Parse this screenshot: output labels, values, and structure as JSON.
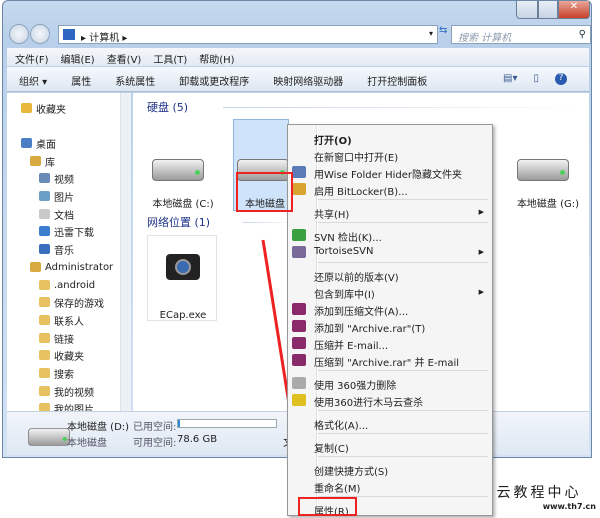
{
  "window": {
    "controls": [
      "minimize",
      "maximize",
      "close"
    ]
  },
  "address": {
    "path": "计算机",
    "search_placeholder": "搜索 计算机"
  },
  "menubar": [
    "文件(F)",
    "编辑(E)",
    "查看(V)",
    "工具(T)",
    "帮助(H)"
  ],
  "toolbar": [
    "组织 ▾",
    "属性",
    "系统属性",
    "卸载或更改程序",
    "映射网络驱动器",
    "打开控制面板"
  ],
  "sidebar": [
    {
      "label": "收藏夹",
      "color": "#e8b83a",
      "indent": 0
    },
    {
      "label": "桌面",
      "color": "#4a7fc6",
      "indent": 0
    },
    {
      "label": "库",
      "color": "#d8a940",
      "indent": 1
    },
    {
      "label": "视频",
      "color": "#6a8bb8",
      "indent": 2
    },
    {
      "label": "图片",
      "color": "#6aa0c8",
      "indent": 2
    },
    {
      "label": "文档",
      "color": "#c9c9c9",
      "indent": 2
    },
    {
      "label": "迅雷下载",
      "color": "#3a7fd0",
      "indent": 2
    },
    {
      "label": "音乐",
      "color": "#3a6fc0",
      "indent": 2
    },
    {
      "label": "Administrator",
      "color": "#d8a940",
      "indent": 1
    },
    {
      "label": ".android",
      "color": "#e8c260",
      "indent": 2
    },
    {
      "label": "保存的游戏",
      "color": "#e8c260",
      "indent": 2
    },
    {
      "label": "联系人",
      "color": "#e8c260",
      "indent": 2
    },
    {
      "label": "链接",
      "color": "#e8c260",
      "indent": 2
    },
    {
      "label": "收藏夹",
      "color": "#e8c260",
      "indent": 2
    },
    {
      "label": "搜索",
      "color": "#e8c260",
      "indent": 2
    },
    {
      "label": "我的视频",
      "color": "#e8c260",
      "indent": 2
    },
    {
      "label": "我的图片",
      "color": "#e8c260",
      "indent": 2
    }
  ],
  "content": {
    "hdd_group": "硬盘 (5)",
    "net_group": "网络位置 (1)",
    "drives": [
      {
        "label": "本地磁盘 (C:)"
      },
      {
        "label": "本地磁盘 (D:)"
      },
      {
        "label": "本地磁盘 (G:)"
      }
    ],
    "network": [
      {
        "label": "ECap.exe"
      }
    ]
  },
  "details": {
    "name": "本地磁盘 (D:)",
    "type": "本地磁盘",
    "used_label": "已用空间:",
    "free_label": "可用空间:",
    "free_value": "78.6 GB",
    "used_fraction": 0.02,
    "extra": "文"
  },
  "context_menu": [
    {
      "label": "打开(O)",
      "bold": true
    },
    {
      "label": "在新窗口中打开(E)"
    },
    {
      "label": "用Wise Folder Hider隐藏文件夹",
      "icon": "#5a7bb5"
    },
    {
      "label": "启用 BitLocker(B)...",
      "icon": "#d9a530"
    },
    {
      "sep": true
    },
    {
      "label": "共享(H)",
      "sub": true
    },
    {
      "sep": true
    },
    {
      "label": "SVN 检出(K)...",
      "icon": "#3aa040"
    },
    {
      "label": "TortoiseSVN",
      "sub": true,
      "icon": "#7a6a9a"
    },
    {
      "sep": true
    },
    {
      "label": "还原以前的版本(V)"
    },
    {
      "label": "包含到库中(I)",
      "sub": true
    },
    {
      "label": "添加到压缩文件(A)...",
      "icon": "#8a2a6a"
    },
    {
      "label": "添加到 \"Archive.rar\"(T)",
      "icon": "#8a2a6a"
    },
    {
      "label": "压缩并 E-mail...",
      "icon": "#8a2a6a"
    },
    {
      "label": "压缩到 \"Archive.rar\" 并 E-mail",
      "icon": "#8a2a6a"
    },
    {
      "sep": true
    },
    {
      "label": "使用 360强力删除",
      "icon": "#aaaaaa"
    },
    {
      "label": "使用360进行木马云查杀",
      "icon": "#e0c020"
    },
    {
      "sep": true
    },
    {
      "label": "格式化(A)..."
    },
    {
      "sep": true
    },
    {
      "label": "复制(C)"
    },
    {
      "sep": true
    },
    {
      "label": "创建快捷方式(S)"
    },
    {
      "label": "重命名(M)"
    },
    {
      "sep": true
    },
    {
      "label": "属性(R)"
    }
  ],
  "watermark": {
    "title": "云教程中心",
    "url": "www.th7.cn"
  },
  "colors": {
    "highlight": "#e22222",
    "accent": "#1e3287"
  }
}
